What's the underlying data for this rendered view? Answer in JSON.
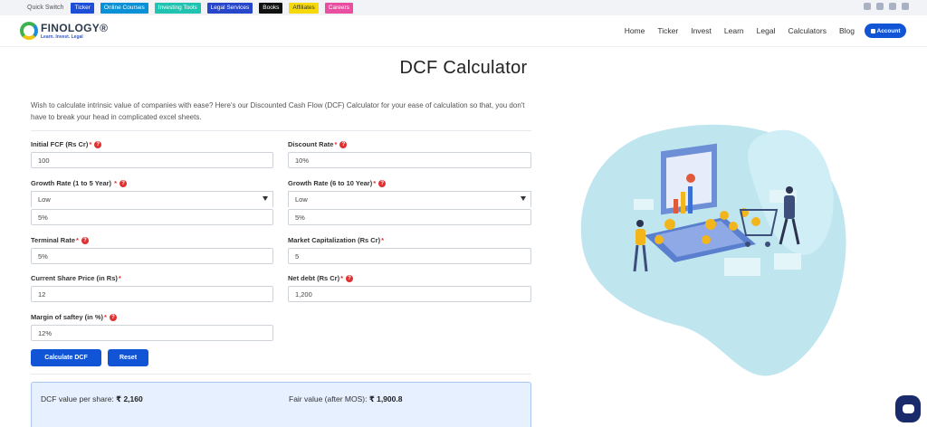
{
  "quickbar": {
    "label": "Quick Switch",
    "tags": [
      {
        "label": "Ticker",
        "color": "#1d4ed8"
      },
      {
        "label": "Online Courses",
        "color": "#0891d6"
      },
      {
        "label": "Investing Tools",
        "color": "#1fc3b0"
      },
      {
        "label": "Legal Services",
        "color": "#2746c9"
      },
      {
        "label": "Books",
        "color": "#111111"
      },
      {
        "label": "Affiliates",
        "color": "#f5d90a"
      },
      {
        "label": "Careers",
        "color": "#e94fa0"
      }
    ]
  },
  "header": {
    "logo_name": "FINOLOGY®",
    "logo_tagline": "Learn. Invest. Legal",
    "nav": [
      "Home",
      "Ticker",
      "Invest",
      "Learn",
      "Legal",
      "Calculators",
      "Blog"
    ],
    "account_label": "Account"
  },
  "page": {
    "title": "DCF Calculator",
    "intro": "Wish to calculate intrinsic value of companies with ease? Here's our Discounted Cash Flow (DCF) Calculator for your ease of calculation so that, you don't have to break your head in complicated excel sheets."
  },
  "form": {
    "initial_fcf": {
      "label": "Initial FCF (Rs Cr)",
      "value": "100"
    },
    "discount_rate": {
      "label": "Discount Rate",
      "value": "10%"
    },
    "growth_1_5": {
      "label": "Growth Rate (1 to 5 Year)",
      "select": "Low",
      "value": "5%"
    },
    "growth_6_10": {
      "label": "Growth Rate (6 to 10 Year)",
      "select": "Low",
      "value": "5%"
    },
    "terminal_rate": {
      "label": "Terminal Rate",
      "value": "5%"
    },
    "market_cap": {
      "label": "Market Capitalization (Rs Cr)",
      "value": "5"
    },
    "share_price": {
      "label": "Current Share Price (in Rs)",
      "value": "12"
    },
    "net_debt": {
      "label": "Net debt (Rs Cr)",
      "value": "1,200"
    },
    "margin_safety": {
      "label": "Margin of saftey (in %)",
      "value": "12%"
    },
    "calculate_label": "Calculate DCF",
    "reset_label": "Reset"
  },
  "result": {
    "dcf_label": "DCF value per share:",
    "dcf_value": "₹ 2,160",
    "fair_label": "Fair value (after MOS):",
    "fair_value": "₹ 1,900.8"
  },
  "colors": {
    "primary": "#1254d6",
    "required": "#e03131",
    "blob": "#bfe6ef"
  }
}
